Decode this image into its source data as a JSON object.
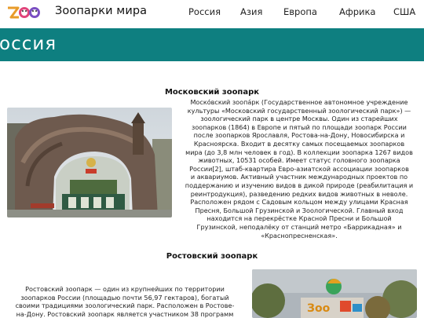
{
  "header": {
    "logo_text": "ZOO",
    "site_title": "Зоопарки мира",
    "nav": [
      "Россия",
      "Азия",
      "Европа",
      "Африка",
      "США"
    ]
  },
  "banner": {
    "title": "оссия"
  },
  "sections": [
    {
      "title": "Московский зоопарк",
      "lines": [
        "Моско́вский зоопа́рк (Государственное автономное учреждение",
        "культуры «Московский государственный зоологический парк») —",
        "зоологический парк в центре Москвы. Один из старейших",
        "зоопарков (1864) в Европе и пятый по площади зоопарк России",
        "после зоопарков Ярославля, Ростова-на-Дону, Новосибирска и",
        "Красноярска. Входит в десятку самых посещаемых зоопарков",
        "мира (до 3,8 млн человек в год). В коллекции зоопарка 1267 видов",
        "животных, 10531 особей. Имеет статус головного зоопарка",
        "России[2], штаб-квартира Евро-азиатской ассоциации зоопарков",
        "и аквариумов. Активный участник международных проектов по",
        "поддержанию и изучению видов в дикой природе (реабилитация и",
        "реинтродукция), разведению редких видов животных в неволе.",
        "Расположен рядом с Садовым кольцом между улицами Красная",
        "Пресня, Большой Грузинской и Зоологической. Главный вход",
        "находится на перекрёстке Красной Пресни и Большой",
        "Грузинской, неподалёку от станций метро «Баррикадная» и",
        "«Краснопресненская»."
      ]
    },
    {
      "title": "Ростовский зоопарк",
      "lines": [
        "Ростовский зоопарк — один из крупнейших по территории",
        "зоопарков России (площадью почти 56,97 гектаров), богатый",
        "своими традициями зоологический парк. Расположен в Ростове-",
        "на-Дону. Ростовский зоопарк является участником 38 программ"
      ],
      "sign_text": "Зоо"
    }
  ],
  "colors": {
    "accent": "#0e7f80"
  }
}
